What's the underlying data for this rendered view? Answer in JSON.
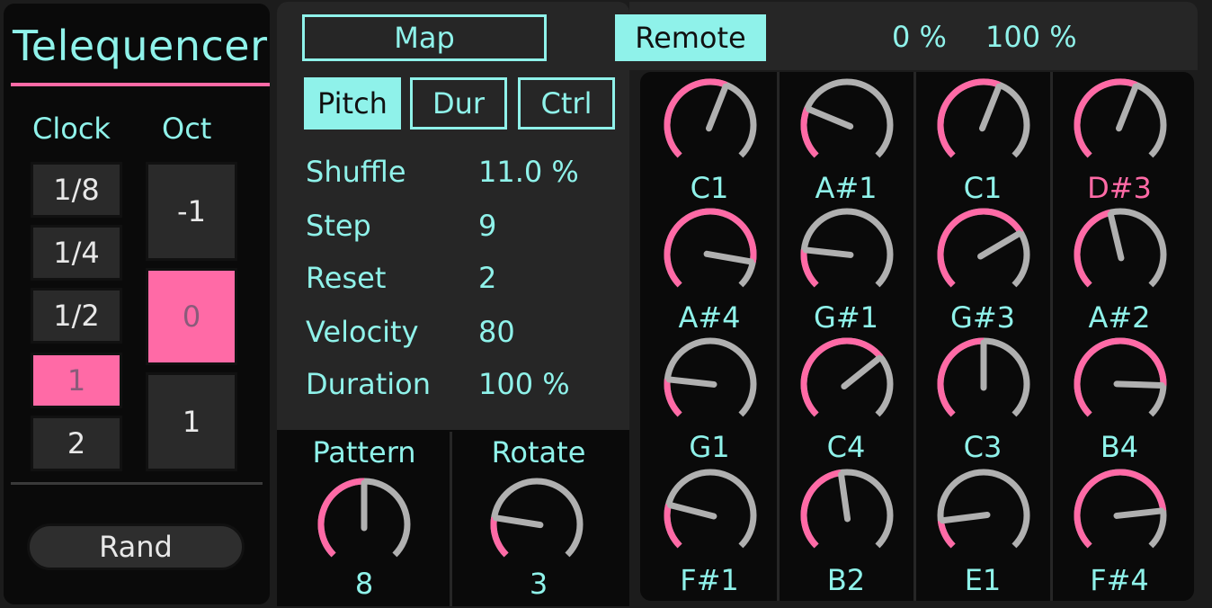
{
  "app": {
    "title": "Telequencer"
  },
  "clock": {
    "label": "Clock",
    "options": [
      "1/8",
      "1/4",
      "1/2",
      "1",
      "2"
    ],
    "selected": "1"
  },
  "oct": {
    "label": "Oct",
    "options": [
      "-1",
      "0",
      "1"
    ],
    "selected": "0"
  },
  "rand": {
    "label": "Rand"
  },
  "top": {
    "map_label": "Map",
    "remote_label": "Remote",
    "min_pct": "0 %",
    "max_pct": "100 %"
  },
  "tabs": {
    "pitch": "Pitch",
    "dur": "Dur",
    "ctrl": "Ctrl",
    "active": "Pitch"
  },
  "params": [
    {
      "label": "Shuffle",
      "value": "11.0 %"
    },
    {
      "label": "Step",
      "value": "9"
    },
    {
      "label": "Reset",
      "value": "2"
    },
    {
      "label": "Velocity",
      "value": "80"
    },
    {
      "label": "Duration",
      "value": "100 %"
    }
  ],
  "pattern": {
    "label": "Pattern",
    "value": "8",
    "fraction": 0.5
  },
  "rotate": {
    "label": "Rotate",
    "value": "3",
    "fraction": 0.2
  },
  "knobs": [
    {
      "note": "C1",
      "fraction": 0.58,
      "highlight": false
    },
    {
      "note": "A#1",
      "fraction": 0.25,
      "highlight": false
    },
    {
      "note": "C1",
      "fraction": 0.58,
      "highlight": false
    },
    {
      "note": "D#3",
      "fraction": 0.58,
      "highlight": true
    },
    {
      "note": "A#4",
      "fraction": 0.87,
      "highlight": false
    },
    {
      "note": "G#1",
      "fraction": 0.19,
      "highlight": false
    },
    {
      "note": "G#3",
      "fraction": 0.72,
      "highlight": false
    },
    {
      "note": "A#2",
      "fraction": 0.45,
      "highlight": false
    },
    {
      "note": "G1",
      "fraction": 0.19,
      "highlight": false
    },
    {
      "note": "C4",
      "fraction": 0.69,
      "highlight": false
    },
    {
      "note": "C3",
      "fraction": 0.5,
      "highlight": false
    },
    {
      "note": "B4",
      "fraction": 0.84,
      "highlight": false
    },
    {
      "note": "F#1",
      "fraction": 0.22,
      "highlight": false
    },
    {
      "note": "B2",
      "fraction": 0.47,
      "highlight": false
    },
    {
      "note": "E1",
      "fraction": 0.14,
      "highlight": false
    },
    {
      "note": "F#4",
      "fraction": 0.81,
      "highlight": false
    }
  ],
  "colors": {
    "accent": "#8ff2ea",
    "active": "#ff6aa6",
    "track": "#b0b0b0",
    "background": "#0a0a0a"
  }
}
